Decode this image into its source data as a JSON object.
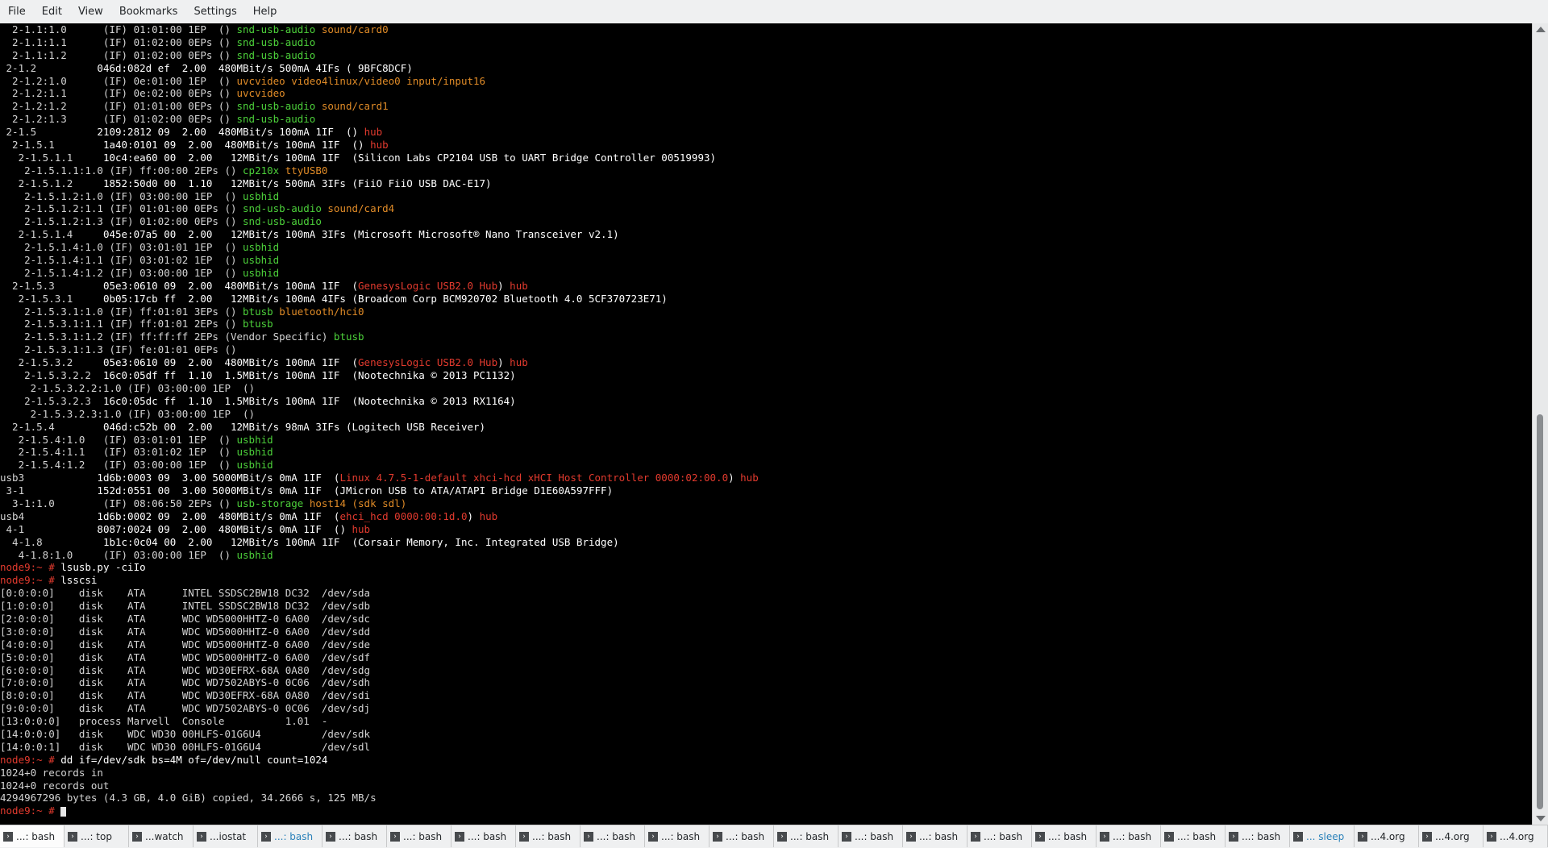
{
  "menu": [
    "File",
    "Edit",
    "View",
    "Bookmarks",
    "Settings",
    "Help"
  ],
  "terminal": {
    "lines": [
      [
        [
          "d",
          "  2-1.1:1.0      (IF) 01:01:00 1EP  () "
        ],
        [
          "g",
          "snd-usb-audio "
        ],
        [
          "o",
          "sound/card0"
        ]
      ],
      [
        [
          "d",
          "  2-1.1:1.1      (IF) 01:02:00 0EPs () "
        ],
        [
          "g",
          "snd-usb-audio"
        ]
      ],
      [
        [
          "d",
          "  2-1.1:1.2      (IF) 01:02:00 0EPs () "
        ],
        [
          "g",
          "snd-usb-audio"
        ]
      ],
      [
        [
          "d",
          " 2-1.2          "
        ],
        [
          "w",
          "046d:082d ef  2.00  480MBit/s 500mA 4IFs ( 9BFC8DCF)"
        ]
      ],
      [
        [
          "d",
          "  2-1.2:1.0      (IF) 0e:01:00 1EP  () "
        ],
        [
          "o",
          "uvcvideo video4linux/video0 input/input16"
        ]
      ],
      [
        [
          "d",
          "  2-1.2:1.1      (IF) 0e:02:00 0EPs () "
        ],
        [
          "o",
          "uvcvideo"
        ]
      ],
      [
        [
          "d",
          "  2-1.2:1.2      (IF) 01:01:00 0EPs () "
        ],
        [
          "g",
          "snd-usb-audio "
        ],
        [
          "o",
          "sound/card1"
        ]
      ],
      [
        [
          "d",
          "  2-1.2:1.3      (IF) 01:02:00 0EPs () "
        ],
        [
          "g",
          "snd-usb-audio"
        ]
      ],
      [
        [
          "d",
          " 2-1.5          "
        ],
        [
          "w",
          "2109:2812 09  2.00  480MBit/s 100mA 1IF  () "
        ],
        [
          "r",
          "hub"
        ]
      ],
      [
        [
          "d",
          "  2-1.5.1        "
        ],
        [
          "w",
          "1a40:0101 09  2.00  480MBit/s 100mA 1IF  () "
        ],
        [
          "r",
          "hub"
        ]
      ],
      [
        [
          "d",
          "   2-1.5.1.1     "
        ],
        [
          "w",
          "10c4:ea60 00  2.00   12MBit/s 100mA 1IF  (Silicon Labs CP2104 USB to UART Bridge Controller 00519993)"
        ]
      ],
      [
        [
          "d",
          "    2-1.5.1.1:1.0 (IF) ff:00:00 2EPs () "
        ],
        [
          "g",
          "cp210x "
        ],
        [
          "o",
          "ttyUSB0"
        ]
      ],
      [
        [
          "d",
          "   2-1.5.1.2     "
        ],
        [
          "w",
          "1852:50d0 00  1.10   12MBit/s 500mA 3IFs (FiiO FiiO USB DAC-E17)"
        ]
      ],
      [
        [
          "d",
          "    2-1.5.1.2:1.0 (IF) 03:00:00 1EP  () "
        ],
        [
          "g",
          "usbhid"
        ]
      ],
      [
        [
          "d",
          "    2-1.5.1.2:1.1 (IF) 01:01:00 0EPs () "
        ],
        [
          "g",
          "snd-usb-audio "
        ],
        [
          "o",
          "sound/card4"
        ]
      ],
      [
        [
          "d",
          "    2-1.5.1.2:1.3 (IF) 01:02:00 0EPs () "
        ],
        [
          "g",
          "snd-usb-audio"
        ]
      ],
      [
        [
          "d",
          "   2-1.5.1.4     "
        ],
        [
          "w",
          "045e:07a5 00  2.00   12MBit/s 100mA 3IFs (Microsoft Microsoft® Nano Transceiver v2.1)"
        ]
      ],
      [
        [
          "d",
          "    2-1.5.1.4:1.0 (IF) 03:01:01 1EP  () "
        ],
        [
          "g",
          "usbhid"
        ]
      ],
      [
        [
          "d",
          "    2-1.5.1.4:1.1 (IF) 03:01:02 1EP  () "
        ],
        [
          "g",
          "usbhid"
        ]
      ],
      [
        [
          "d",
          "    2-1.5.1.4:1.2 (IF) 03:00:00 1EP  () "
        ],
        [
          "g",
          "usbhid"
        ]
      ],
      [
        [
          "d",
          "  2-1.5.3        "
        ],
        [
          "w",
          "05e3:0610 09  2.00  480MBit/s 100mA 1IF  ("
        ],
        [
          "r",
          "GenesysLogic USB2.0 Hub"
        ],
        [
          "w",
          ") "
        ],
        [
          "r",
          "hub"
        ]
      ],
      [
        [
          "d",
          "   2-1.5.3.1     "
        ],
        [
          "w",
          "0b05:17cb ff  2.00   12MBit/s 100mA 4IFs (Broadcom Corp BCM920702 Bluetooth 4.0 5CF370723E71)"
        ]
      ],
      [
        [
          "d",
          "    2-1.5.3.1:1.0 (IF) ff:01:01 3EPs () "
        ],
        [
          "g",
          "btusb "
        ],
        [
          "o",
          "bluetooth/hci0"
        ]
      ],
      [
        [
          "d",
          "    2-1.5.3.1:1.1 (IF) ff:01:01 2EPs () "
        ],
        [
          "g",
          "btusb"
        ]
      ],
      [
        [
          "d",
          "    2-1.5.3.1:1.2 (IF) ff:ff:ff 2EPs (Vendor Specific) "
        ],
        [
          "g",
          "btusb"
        ]
      ],
      [
        [
          "d",
          "    2-1.5.3.1:1.3 (IF) fe:01:01 0EPs ()"
        ]
      ],
      [
        [
          "d",
          "   2-1.5.3.2     "
        ],
        [
          "w",
          "05e3:0610 09  2.00  480MBit/s 100mA 1IF  ("
        ],
        [
          "r",
          "GenesysLogic USB2.0 Hub"
        ],
        [
          "w",
          ") "
        ],
        [
          "r",
          "hub"
        ]
      ],
      [
        [
          "d",
          "    2-1.5.3.2.2  "
        ],
        [
          "w",
          "16c0:05df ff  1.10  1.5MBit/s 100mA 1IF  (Nootechnika © 2013 PC1132)"
        ]
      ],
      [
        [
          "d",
          "     2-1.5.3.2.2:1.0 (IF) 03:00:00 1EP  ()"
        ]
      ],
      [
        [
          "d",
          "    2-1.5.3.2.3  "
        ],
        [
          "w",
          "16c0:05dc ff  1.10  1.5MBit/s 100mA 1IF  (Nootechnika © 2013 RX1164)"
        ]
      ],
      [
        [
          "d",
          "     2-1.5.3.2.3:1.0 (IF) 03:00:00 1EP  ()"
        ]
      ],
      [
        [
          "d",
          "  2-1.5.4        "
        ],
        [
          "w",
          "046d:c52b 00  2.00   12MBit/s 98mA 3IFs (Logitech USB Receiver)"
        ]
      ],
      [
        [
          "d",
          "   2-1.5.4:1.0   (IF) 03:01:01 1EP  () "
        ],
        [
          "g",
          "usbhid"
        ]
      ],
      [
        [
          "d",
          "   2-1.5.4:1.1   (IF) 03:01:02 1EP  () "
        ],
        [
          "g",
          "usbhid"
        ]
      ],
      [
        [
          "d",
          "   2-1.5.4:1.2   (IF) 03:00:00 1EP  () "
        ],
        [
          "g",
          "usbhid"
        ]
      ],
      [
        [
          "d",
          "usb3            "
        ],
        [
          "w",
          "1d6b:0003 09  3.00 5000MBit/s 0mA 1IF  ("
        ],
        [
          "r",
          "Linux 4.7.5-1-default xhci-hcd xHCI Host Controller 0000:02:00.0"
        ],
        [
          "w",
          ") "
        ],
        [
          "r",
          "hub"
        ]
      ],
      [
        [
          "d",
          " 3-1            "
        ],
        [
          "w",
          "152d:0551 00  3.00 5000MBit/s 0mA 1IF  (JMicron USB to ATA/ATAPI Bridge D1E60A597FFF)"
        ]
      ],
      [
        [
          "d",
          "  3-1:1.0        (IF) 08:06:50 2EPs () "
        ],
        [
          "g",
          "usb-storage "
        ],
        [
          "o",
          "host14 (sdk sdl)"
        ]
      ],
      [
        [
          "d",
          "usb4            "
        ],
        [
          "w",
          "1d6b:0002 09  2.00  480MBit/s 0mA 1IF  ("
        ],
        [
          "r",
          "ehci_hcd 0000:00:1d.0"
        ],
        [
          "w",
          ") "
        ],
        [
          "r",
          "hub"
        ]
      ],
      [
        [
          "d",
          " 4-1            "
        ],
        [
          "w",
          "8087:0024 09  2.00  480MBit/s 0mA 1IF  () "
        ],
        [
          "r",
          "hub"
        ]
      ],
      [
        [
          "d",
          "  4-1.8          "
        ],
        [
          "w",
          "1b1c:0c04 00  2.00   12MBit/s 100mA 1IF  (Corsair Memory, Inc. Integrated USB Bridge)"
        ]
      ],
      [
        [
          "d",
          "   4-1.8:1.0     (IF) 03:00:00 1EP  () "
        ],
        [
          "g",
          "usbhid"
        ]
      ],
      [
        [
          "p",
          "node9:~ # "
        ],
        [
          "w",
          "lsusb.py -ciIo"
        ]
      ],
      [
        [
          "p",
          "node9:~ # "
        ],
        [
          "w",
          "lsscsi"
        ]
      ],
      [
        [
          "d",
          "[0:0:0:0]    disk    ATA      INTEL SSDSC2BW18 DC32  /dev/sda"
        ]
      ],
      [
        [
          "d",
          "[1:0:0:0]    disk    ATA      INTEL SSDSC2BW18 DC32  /dev/sdb"
        ]
      ],
      [
        [
          "d",
          "[2:0:0:0]    disk    ATA      WDC WD5000HHTZ-0 6A00  /dev/sdc"
        ]
      ],
      [
        [
          "d",
          "[3:0:0:0]    disk    ATA      WDC WD5000HHTZ-0 6A00  /dev/sdd"
        ]
      ],
      [
        [
          "d",
          "[4:0:0:0]    disk    ATA      WDC WD5000HHTZ-0 6A00  /dev/sde"
        ]
      ],
      [
        [
          "d",
          "[5:0:0:0]    disk    ATA      WDC WD5000HHTZ-0 6A00  /dev/sdf"
        ]
      ],
      [
        [
          "d",
          "[6:0:0:0]    disk    ATA      WDC WD30EFRX-68A 0A80  /dev/sdg"
        ]
      ],
      [
        [
          "d",
          "[7:0:0:0]    disk    ATA      WDC WD7502ABYS-0 0C06  /dev/sdh"
        ]
      ],
      [
        [
          "d",
          "[8:0:0:0]    disk    ATA      WDC WD30EFRX-68A 0A80  /dev/sdi"
        ]
      ],
      [
        [
          "d",
          "[9:0:0:0]    disk    ATA      WDC WD7502ABYS-0 0C06  /dev/sdj"
        ]
      ],
      [
        [
          "d",
          "[13:0:0:0]   process Marvell  Console          1.01  -"
        ]
      ],
      [
        [
          "d",
          "[14:0:0:0]   disk    WDC WD30 00HLFS-01G6U4          /dev/sdk"
        ]
      ],
      [
        [
          "d",
          "[14:0:0:1]   disk    WDC WD30 00HLFS-01G6U4          /dev/sdl"
        ]
      ],
      [
        [
          "p",
          "node9:~ # "
        ],
        [
          "w",
          "dd if=/dev/sdk bs=4M of=/dev/null count=1024"
        ]
      ],
      [
        [
          "d",
          "1024+0 records in"
        ]
      ],
      [
        [
          "d",
          "1024+0 records out"
        ]
      ],
      [
        [
          "d",
          "4294967296 bytes (4.3 GB, 4.0 GiB) copied, 34.2666 s, 125 MB/s"
        ]
      ],
      [
        [
          "p",
          "node9:~ # "
        ]
      ]
    ]
  },
  "tabs": [
    {
      "label": "...: bash",
      "active": true
    },
    {
      "label": "...: top"
    },
    {
      "label": "...watch"
    },
    {
      "label": "...iostat"
    },
    {
      "label": "...: bash",
      "hl": true
    },
    {
      "label": "...: bash"
    },
    {
      "label": "...: bash"
    },
    {
      "label": "...: bash"
    },
    {
      "label": "...: bash"
    },
    {
      "label": "...: bash"
    },
    {
      "label": "...: bash"
    },
    {
      "label": "...: bash"
    },
    {
      "label": "...: bash"
    },
    {
      "label": "...: bash"
    },
    {
      "label": "...: bash"
    },
    {
      "label": "...: bash"
    },
    {
      "label": "...: bash"
    },
    {
      "label": "...: bash"
    },
    {
      "label": "...: bash"
    },
    {
      "label": "...: bash"
    },
    {
      "label": "... sleep",
      "hl": true
    },
    {
      "label": "...4.org"
    },
    {
      "label": "...4.org"
    },
    {
      "label": "...4.org"
    }
  ]
}
